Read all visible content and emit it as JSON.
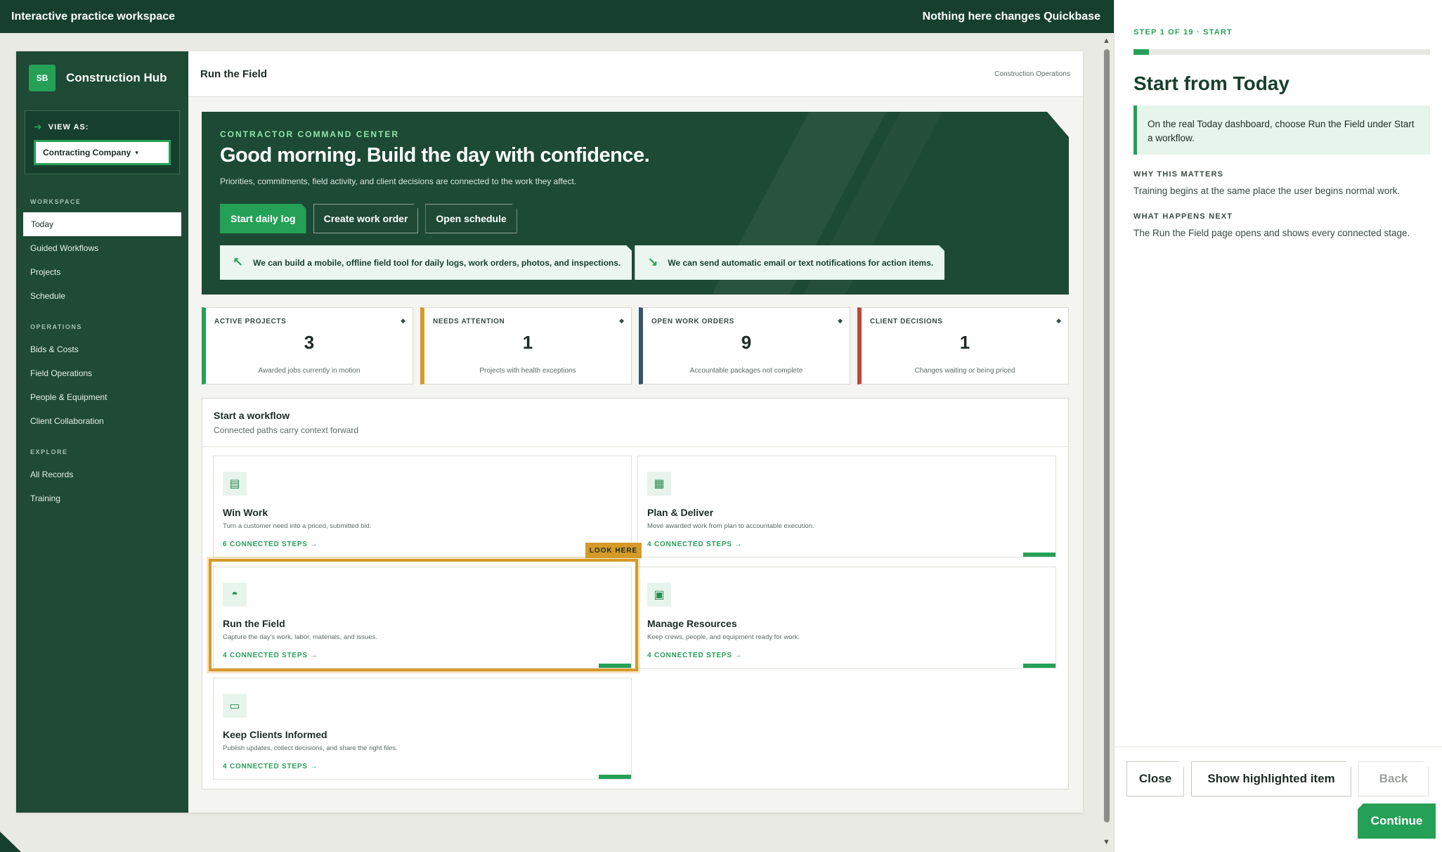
{
  "topbar": {
    "left": "Interactive practice workspace",
    "right": "Nothing here changes Quickbase"
  },
  "sidebar": {
    "brand_badge": "SB",
    "brand_name": "Construction Hub",
    "view_as_label": "VIEW AS:",
    "view_as_value": "Contracting Company",
    "sections": [
      {
        "label": "WORKSPACE",
        "items": [
          "Today",
          "Guided Workflows",
          "Projects",
          "Schedule"
        ]
      },
      {
        "label": "OPERATIONS",
        "items": [
          "Bids & Costs",
          "Field Operations",
          "People & Equipment",
          "Client Collaboration"
        ]
      },
      {
        "label": "EXPLORE",
        "items": [
          "All Records",
          "Training"
        ]
      }
    ]
  },
  "page": {
    "title": "Run the Field",
    "crumb": "Construction Operations"
  },
  "hero": {
    "kicker": "CONTRACTOR COMMAND CENTER",
    "title": "Good morning. Build the day with confidence.",
    "subtitle": "Priorities, commitments, field activity, and client decisions are connected to the work they affect.",
    "buttons": [
      "Start daily log",
      "Create work order",
      "Open schedule"
    ],
    "notes": [
      {
        "icon": "↖",
        "text": "We can build a mobile, offline field tool for daily logs, work orders, photos, and inspections."
      },
      {
        "icon": "↘",
        "text": "We can send automatic email or text notifications for action items."
      }
    ]
  },
  "stats": [
    {
      "label": "ACTIVE PROJECTS",
      "value": "3",
      "sub": "Awarded jobs currently in motion",
      "color": "#25a057"
    },
    {
      "label": "NEEDS ATTENTION",
      "value": "1",
      "sub": "Projects with health exceptions",
      "color": "#d59a27"
    },
    {
      "label": "OPEN WORK ORDERS",
      "value": "9",
      "sub": "Accountable packages not complete",
      "color": "#35566b"
    },
    {
      "label": "CLIENT DECISIONS",
      "value": "1",
      "sub": "Changes waiting or being priced",
      "color": "#c0443a"
    }
  ],
  "workflow": {
    "title": "Start a workflow",
    "subtitle": "Connected paths carry context forward",
    "look_here": "LOOK HERE",
    "cards": [
      {
        "title": "Win Work",
        "desc": "Turn a customer need into a priced, submitted bid.",
        "steps": "6 CONNECTED STEPS →",
        "icon": "document-icon"
      },
      {
        "title": "Plan & Deliver",
        "desc": "Move awarded work from plan to accountable execution.",
        "steps": "4 CONNECTED STEPS →",
        "icon": "building-icon"
      },
      {
        "title": "Run the Field",
        "desc": "Capture the day's work, labor, materials, and issues.",
        "steps": "4 CONNECTED STEPS →",
        "icon": "hardhat-icon"
      },
      {
        "title": "Manage Resources",
        "desc": "Keep crews, people, and equipment ready for work.",
        "steps": "4 CONNECTED STEPS →",
        "icon": "truck-icon"
      },
      {
        "title": "Keep Clients Informed",
        "desc": "Publish updates, collect decisions, and share the right files.",
        "steps": "4 CONNECTED STEPS →",
        "icon": "message-icon"
      }
    ]
  },
  "panel": {
    "step": "STEP 1 OF 19 · START",
    "progress": 0.053,
    "title": "Start from Today",
    "callout": "On the real Today dashboard, choose Run the Field under Start a workflow.",
    "why_label": "WHY THIS MATTERS",
    "why_text": "Training begins at the same place the user begins normal work.",
    "next_label": "WHAT HAPPENS NEXT",
    "next_text": "The Run the Field page opens and shows every connected stage.",
    "buttons": {
      "close": "Close",
      "show": "Show highlighted item",
      "back": "Back",
      "continue": "Continue"
    }
  }
}
